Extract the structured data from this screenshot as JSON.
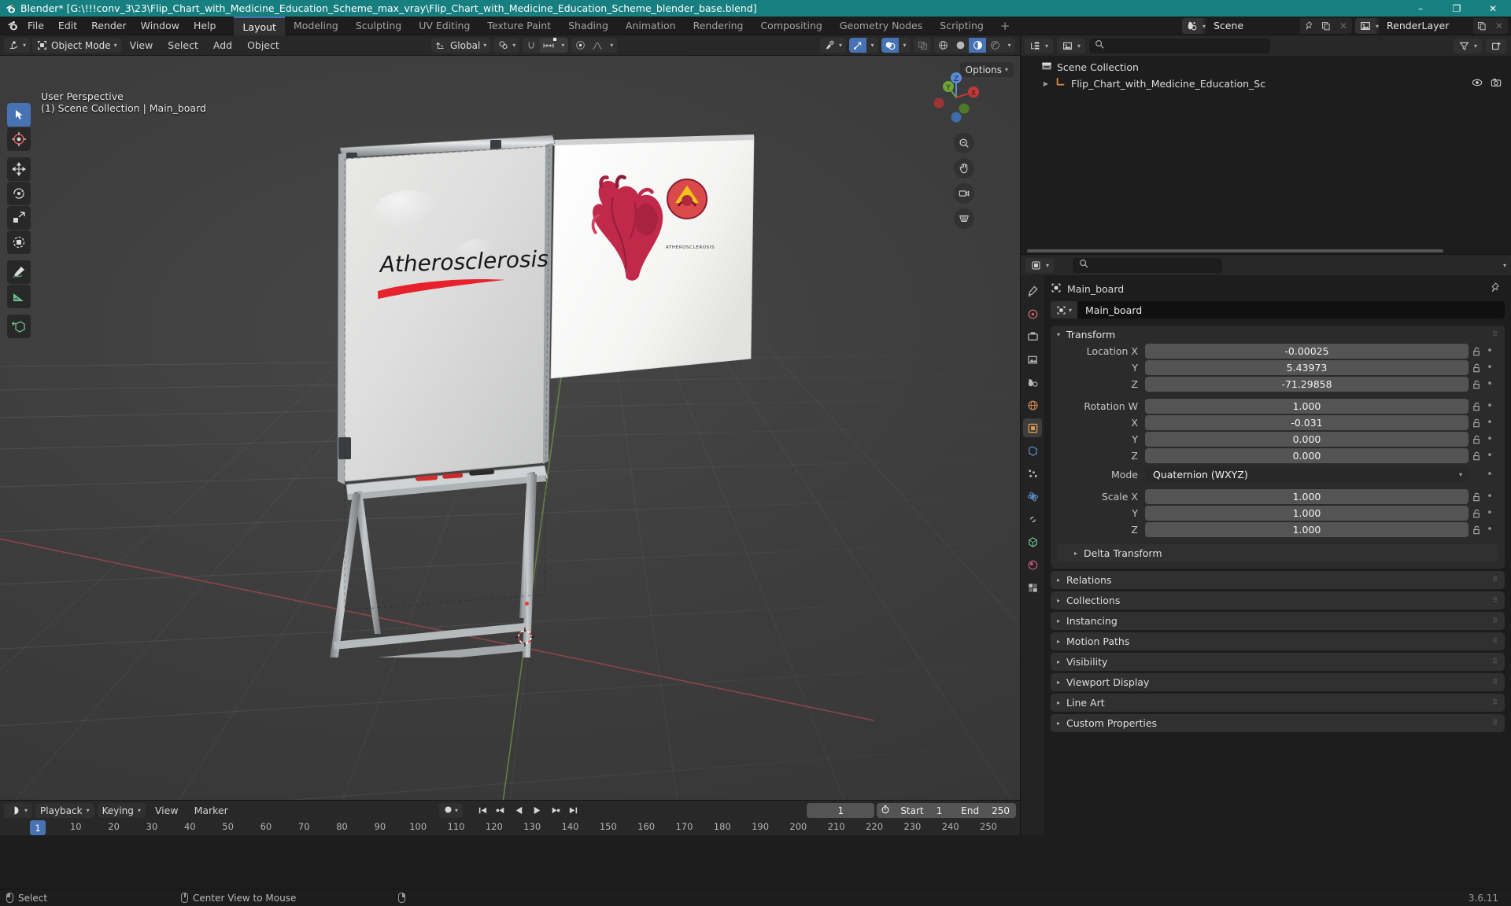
{
  "window": {
    "title": "Blender* [G:\\!!!conv_3\\23\\Flip_Chart_with_Medicine_Education_Scheme_max_vray\\Flip_Chart_with_Medicine_Education_Scheme_blender_base.blend]",
    "minimize": "–",
    "maximize": "❐",
    "close": "✕"
  },
  "topbar": {
    "menus": [
      "File",
      "Edit",
      "Render",
      "Window",
      "Help"
    ],
    "workspaces": [
      "Layout",
      "Modeling",
      "Sculpting",
      "UV Editing",
      "Texture Paint",
      "Shading",
      "Animation",
      "Rendering",
      "Compositing",
      "Geometry Nodes",
      "Scripting"
    ],
    "active_workspace": "Layout",
    "add_workspace": "+",
    "scene_name": "Scene",
    "viewlayer_name": "RenderLayer"
  },
  "viewport": {
    "mode": "Object Mode",
    "menus": [
      "View",
      "Select",
      "Add",
      "Object"
    ],
    "transform_orientation": "Global",
    "options_label": "Options",
    "overlay_line1": "User Perspective",
    "overlay_line2": "(1) Scene Collection | Main_board",
    "gizmo_axes": [
      "X",
      "Y",
      "Z"
    ],
    "tools": [
      "tweak-select-tool",
      "cursor-tool",
      "move-tool",
      "rotate-tool",
      "scale-tool",
      "transform-tool",
      "annotate-tool",
      "measure-tool",
      "add-cube-tool"
    ],
    "scene_text": {
      "flipchart_title": "Atherosclerosis",
      "poster_caption": "ATHEROSCLEROSIS"
    }
  },
  "outliner": {
    "search_placeholder": "",
    "display_mode": "View Layer",
    "items": [
      {
        "label": "Scene Collection",
        "type": "collection",
        "depth": 0
      },
      {
        "label": "Flip_Chart_with_Medicine_Education_Sc",
        "type": "object",
        "depth": 1
      }
    ]
  },
  "properties": {
    "search_placeholder": "",
    "breadcrumb_object": "Main_board",
    "id_name": "Main_board",
    "transform": {
      "title": "Transform",
      "rows": [
        {
          "label": "Location X",
          "value": "-0.00025"
        },
        {
          "label": "Y",
          "value": "5.43973"
        },
        {
          "label": "Z",
          "value": "-71.29858"
        },
        {
          "label": "Rotation W",
          "value": "1.000"
        },
        {
          "label": "X",
          "value": "-0.031"
        },
        {
          "label": "Y",
          "value": "0.000"
        },
        {
          "label": "Z",
          "value": "0.000"
        },
        {
          "label": "Mode",
          "value": "Quaternion (WXYZ)",
          "type": "dropdown"
        },
        {
          "label": "Scale X",
          "value": "1.000"
        },
        {
          "label": "Y",
          "value": "1.000"
        },
        {
          "label": "Z",
          "value": "1.000"
        }
      ]
    },
    "subpanel": "Delta Transform",
    "panels": [
      "Relations",
      "Collections",
      "Instancing",
      "Motion Paths",
      "Visibility",
      "Viewport Display",
      "Line Art",
      "Custom Properties"
    ],
    "tabs": [
      "tool-tab",
      "render-tab",
      "output-tab",
      "viewlayer-tab",
      "scene-tab",
      "world-tab",
      "object-tab",
      "modifiers-tab",
      "particles-tab",
      "physics-tab",
      "constraints-tab",
      "data-tab",
      "material-tab",
      "texture-tab"
    ]
  },
  "timeline": {
    "menus": [
      "Playback",
      "Keying",
      "View",
      "Marker"
    ],
    "current_frame": "1",
    "start_label": "Start",
    "start_value": "1",
    "end_label": "End",
    "end_value": "250",
    "ticks": [
      "1",
      "10",
      "20",
      "30",
      "40",
      "50",
      "60",
      "70",
      "80",
      "90",
      "100",
      "110",
      "120",
      "130",
      "140",
      "150",
      "160",
      "170",
      "180",
      "190",
      "200",
      "210",
      "220",
      "230",
      "240",
      "250"
    ],
    "playhead_frame": "1"
  },
  "statusbar": {
    "items": [
      {
        "icon": "mouse-left-icon",
        "label": "Select"
      },
      {
        "icon": "mouse-middle-icon",
        "label": "Center View to Mouse"
      },
      {
        "icon": "mouse-right-icon",
        "label": ""
      }
    ],
    "version": "3.6.11"
  },
  "colors": {
    "title_bar": "#177f7f",
    "accent_blue": "#4772b3",
    "panel_bg": "#303030",
    "editor_bg": "#1d1d1d",
    "viewport_bg": "#3b3b3b",
    "axis_x_red": "#c64747",
    "axis_y_green": "#7bb345",
    "marker_red": "#ee3a3a"
  }
}
